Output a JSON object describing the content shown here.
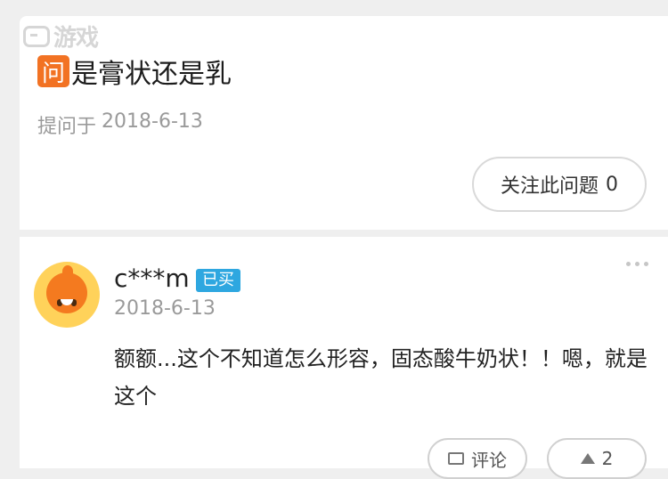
{
  "watermark": {
    "text": "游戏"
  },
  "question": {
    "badge": "问",
    "title": "是膏状还是乳",
    "asked_label": "提问于",
    "asked_date": "2018-6-13",
    "follow_label": "关注此问题",
    "follow_count": "0"
  },
  "answer": {
    "user_name": "c***m",
    "purchase_badge": "已买",
    "date": "2018-6-13",
    "text": "额额...这个不知道怎么形容，固态酸牛奶状！！嗯，就是这个",
    "comment_label": "评论",
    "like_count": "2"
  },
  "icons": {
    "avatar": "avatar",
    "more": "more-icon",
    "comment": "comment-icon",
    "like": "thumb-up-icon"
  },
  "colors": {
    "badge_orange": "#f27223",
    "buy_blue": "#2ea7e0",
    "meta_gray": "#9a9a9a"
  }
}
